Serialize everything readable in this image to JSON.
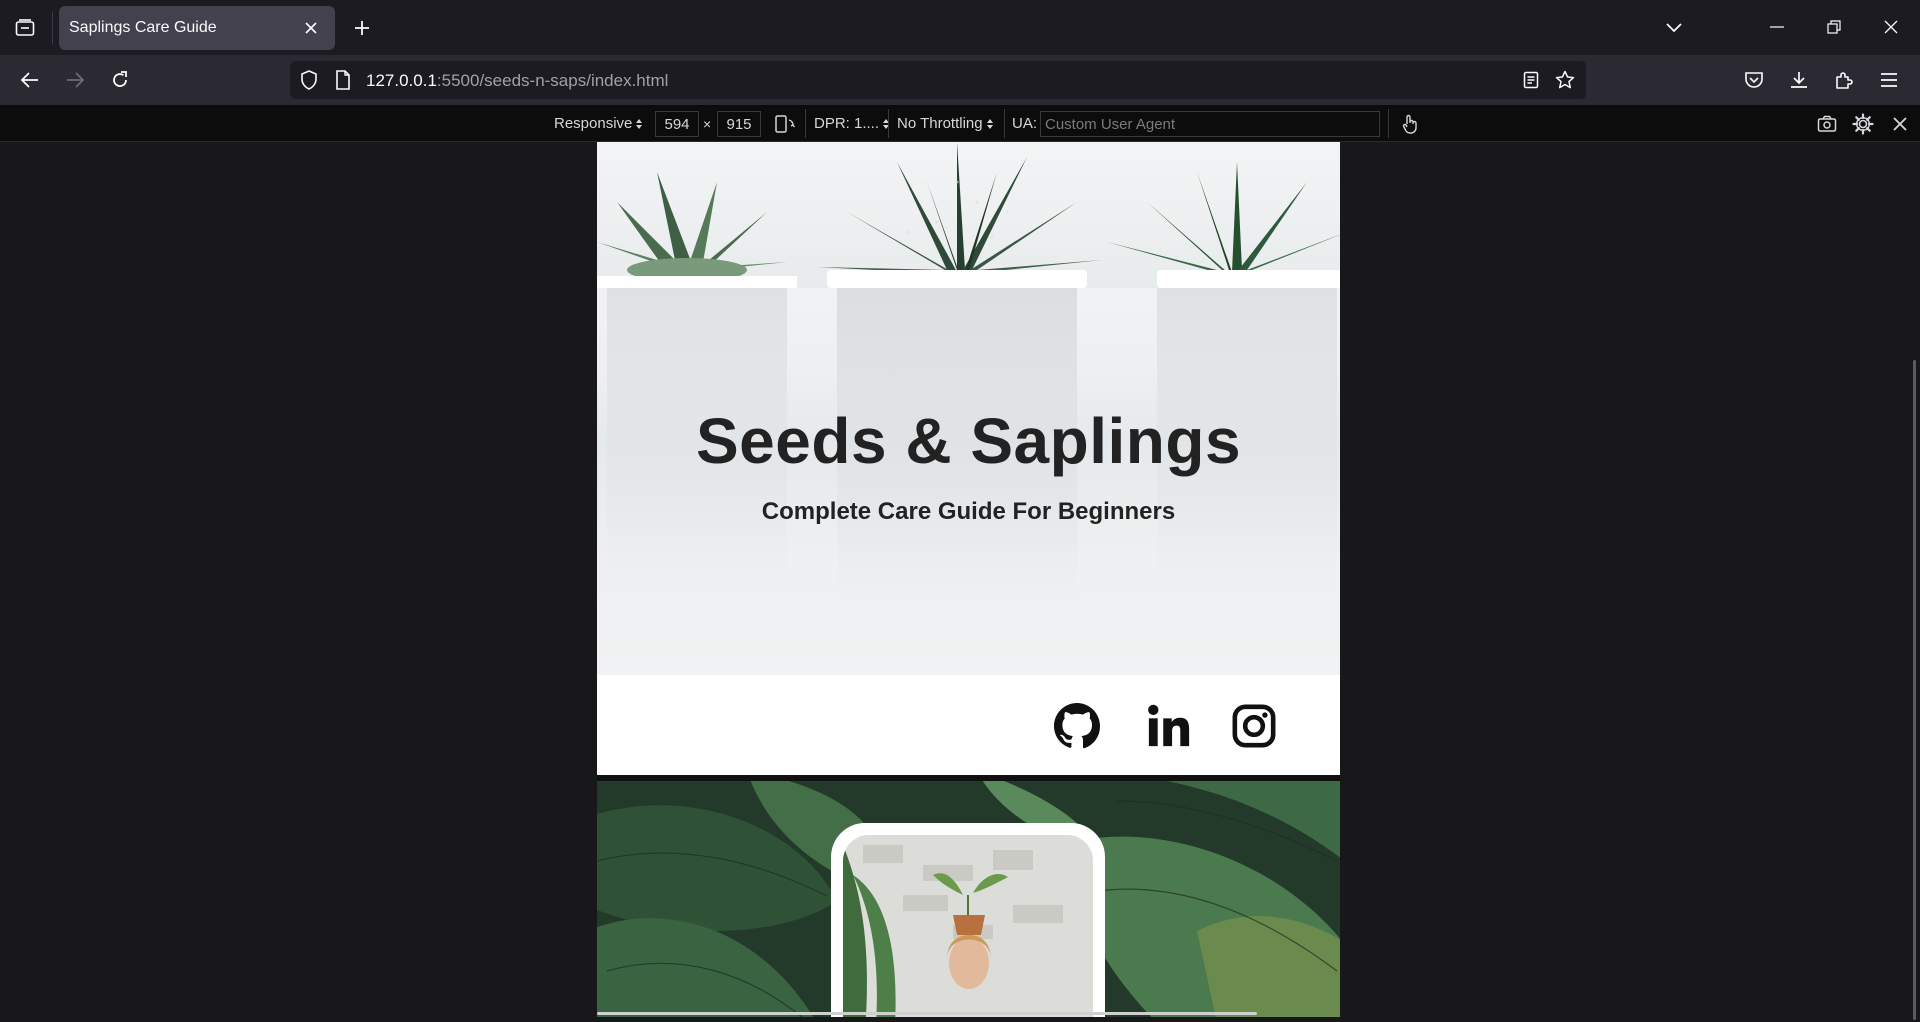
{
  "browser": {
    "tab": {
      "title": "Saplings Care Guide"
    },
    "url": {
      "host": "127.0.0.1",
      "path": ":5500/seeds-n-saps/index.html"
    }
  },
  "rdm": {
    "device": "Responsive",
    "width": "594",
    "times": "×",
    "height": "915",
    "dpr": "DPR: 1....",
    "throttling": "No Throttling",
    "ua_label": "UA:",
    "ua_placeholder": "Custom User Agent"
  },
  "page": {
    "title": "Seeds & Saplings",
    "subtitle": "Complete Care Guide For Beginners",
    "social": [
      "github-icon",
      "linkedin-icon",
      "instagram-icon"
    ]
  }
}
